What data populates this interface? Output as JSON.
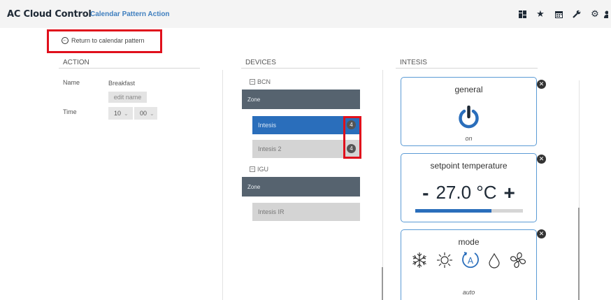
{
  "header": {
    "brand": "AC Cloud Control",
    "separator": "-",
    "page_title": "Calendar Pattern Action",
    "icons": [
      "dashboard-icon",
      "star-icon",
      "calendar-icon",
      "wrench-icon",
      "gear-icon",
      "user-icon"
    ]
  },
  "return_link": {
    "label": "Return to calendar pattern"
  },
  "action": {
    "heading": "ACTION",
    "name_label": "Name",
    "name_value": "Breakfast",
    "edit_name_label": "edit name",
    "time_label": "Time",
    "time_hour": "10",
    "time_minute": "00"
  },
  "devices": {
    "heading": "DEVICES",
    "groups": [
      {
        "name": "BCN",
        "zone_label": "Zone",
        "items": [
          {
            "label": "Intesis",
            "badge": "4",
            "selected": true
          },
          {
            "label": "Intesis 2",
            "badge": "4",
            "selected": false
          }
        ]
      },
      {
        "name": "IGU",
        "zone_label": "Zone",
        "items": [
          {
            "label": "Intesis IR",
            "selected": false
          }
        ]
      }
    ]
  },
  "intesis": {
    "heading": "INTESIS",
    "general": {
      "title": "general",
      "state": "on"
    },
    "setpoint": {
      "title": "setpoint temperature",
      "minus": "-",
      "value": "27.0 °C",
      "plus": "+",
      "level_fraction": 0.71
    },
    "mode": {
      "title": "mode",
      "current": "auto",
      "options": [
        "cool",
        "heat",
        "auto",
        "dry",
        "fan"
      ]
    }
  },
  "colors": {
    "accent": "#2a6ebb",
    "zone_bar": "#56636f",
    "highlight": "#e0101c",
    "brand": "#1f2a36"
  }
}
